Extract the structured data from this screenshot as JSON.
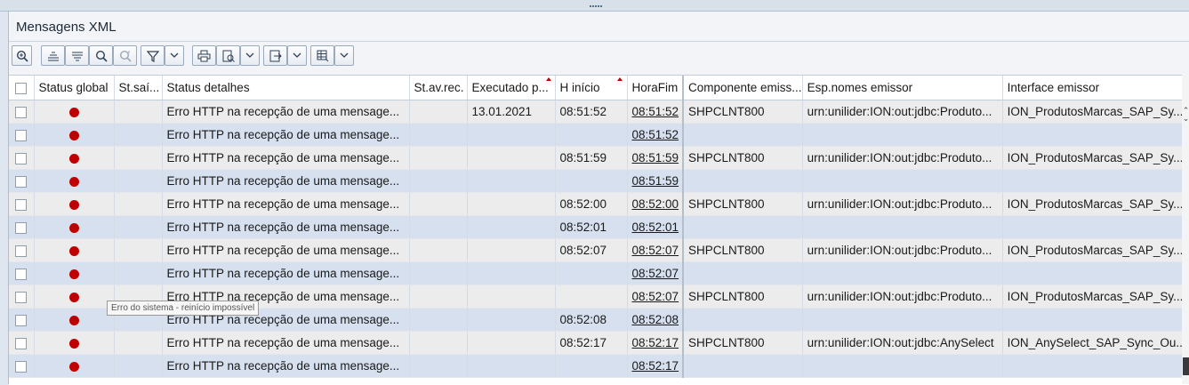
{
  "panel": {
    "title": "Mensagens XML"
  },
  "toolbar": [
    {
      "name": "zoom-details-button",
      "icon": "magnifier-plus-icon"
    },
    {
      "name": "sort-ascending-button",
      "icon": "sort-ascending-icon"
    },
    {
      "name": "sort-descending-button",
      "icon": "sort-descending-icon"
    },
    {
      "name": "find-button",
      "icon": "search-icon"
    },
    {
      "name": "find-next-button",
      "icon": "search-next-icon"
    },
    {
      "name": "filter-button",
      "icon": "funnel-icon"
    },
    {
      "name": "print-button",
      "icon": "printer-icon"
    },
    {
      "name": "view-button",
      "icon": "document-view-icon"
    },
    {
      "name": "export-button",
      "icon": "export-icon"
    },
    {
      "name": "layout-button",
      "icon": "table-layout-icon"
    }
  ],
  "columns": [
    {
      "label": "Status global"
    },
    {
      "label": "St.saí..."
    },
    {
      "label": "Status detalhes"
    },
    {
      "label": "St.av.rec."
    },
    {
      "label": "Executado p..."
    },
    {
      "label": "H início"
    },
    {
      "label": "HoraFim"
    },
    {
      "label": "Componente emiss..."
    },
    {
      "label": "Esp.nomes emissor"
    },
    {
      "label": "Interface emissor"
    }
  ],
  "sort_markers": [
    "Executado p...",
    "H início"
  ],
  "rows": [
    {
      "status_global": "error",
      "status_detalhes": "Erro HTTP na recepção de uma mensage...",
      "executado": "13.01.2021",
      "h_inicio": "08:51:52",
      "hora_fim": "08:51:52",
      "componente": "SHPCLNT800",
      "esp_nomes": "urn:unilider:ION:out:jdbc:Produto...",
      "interface": "ION_ProdutosMarcas_SAP_Sy..."
    },
    {
      "status_global": "error",
      "status_detalhes": "Erro HTTP na recepção de uma mensage...",
      "executado": "",
      "h_inicio": "",
      "hora_fim": "08:51:52",
      "componente": "",
      "esp_nomes": "",
      "interface": ""
    },
    {
      "status_global": "error",
      "status_detalhes": "Erro HTTP na recepção de uma mensage...",
      "executado": "",
      "h_inicio": "08:51:59",
      "hora_fim": "08:51:59",
      "componente": "SHPCLNT800",
      "esp_nomes": "urn:unilider:ION:out:jdbc:Produto...",
      "interface": "ION_ProdutosMarcas_SAP_Sy..."
    },
    {
      "status_global": "error",
      "status_detalhes": "Erro HTTP na recepção de uma mensage...",
      "executado": "",
      "h_inicio": "",
      "hora_fim": "08:51:59",
      "componente": "",
      "esp_nomes": "",
      "interface": ""
    },
    {
      "status_global": "error",
      "status_detalhes": "Erro HTTP na recepção de uma mensage...",
      "executado": "",
      "h_inicio": "08:52:00",
      "hora_fim": "08:52:00",
      "componente": "SHPCLNT800",
      "esp_nomes": "urn:unilider:ION:out:jdbc:Produto...",
      "interface": "ION_ProdutosMarcas_SAP_Sy..."
    },
    {
      "status_global": "error",
      "status_detalhes": "Erro HTTP na recepção de uma mensage...",
      "executado": "",
      "h_inicio": "08:52:01",
      "hora_fim": "08:52:01",
      "componente": "",
      "esp_nomes": "",
      "interface": ""
    },
    {
      "status_global": "error",
      "status_detalhes": "Erro HTTP na recepção de uma mensage...",
      "executado": "",
      "h_inicio": "08:52:07",
      "hora_fim": "08:52:07",
      "componente": "SHPCLNT800",
      "esp_nomes": "urn:unilider:ION:out:jdbc:Produto...",
      "interface": "ION_ProdutosMarcas_SAP_Sy..."
    },
    {
      "status_global": "error",
      "status_detalhes": "Erro HTTP na recepção de uma mensage...",
      "executado": "",
      "h_inicio": "",
      "hora_fim": "08:52:07",
      "componente": "",
      "esp_nomes": "",
      "interface": ""
    },
    {
      "status_global": "error",
      "status_detalhes": "Erro HTTP na recepção de uma mensage...",
      "executado": "",
      "h_inicio": "",
      "hora_fim": "08:52:07",
      "componente": "SHPCLNT800",
      "esp_nomes": "urn:unilider:ION:out:jdbc:Produto...",
      "interface": "ION_ProdutosMarcas_SAP_Sy..."
    },
    {
      "status_global": "error",
      "status_detalhes": "Erro HTTP na recepção de uma mensage...",
      "executado": "",
      "h_inicio": "08:52:08",
      "hora_fim": "08:52:08",
      "componente": "",
      "esp_nomes": "",
      "interface": ""
    },
    {
      "status_global": "error",
      "status_detalhes": "Erro HTTP na recepção de uma mensage...",
      "executado": "",
      "h_inicio": "08:52:17",
      "hora_fim": "08:52:17",
      "componente": "SHPCLNT800",
      "esp_nomes": "urn:unilider:ION:out:jdbc:AnySelect",
      "interface": "ION_AnySelect_SAP_Sync_Ou..."
    },
    {
      "status_global": "error",
      "status_detalhes": "Erro HTTP na recepção de uma mensage...",
      "executado": "",
      "h_inicio": "",
      "hora_fim": "08:52:17",
      "componente": "",
      "esp_nomes": "",
      "interface": ""
    }
  ],
  "tooltip": {
    "text": "Erro do sistema - reinício impossível"
  },
  "colors": {
    "status_error": "#c00000",
    "row_alt": "#d6e0ef",
    "row_base": "#ececec"
  }
}
